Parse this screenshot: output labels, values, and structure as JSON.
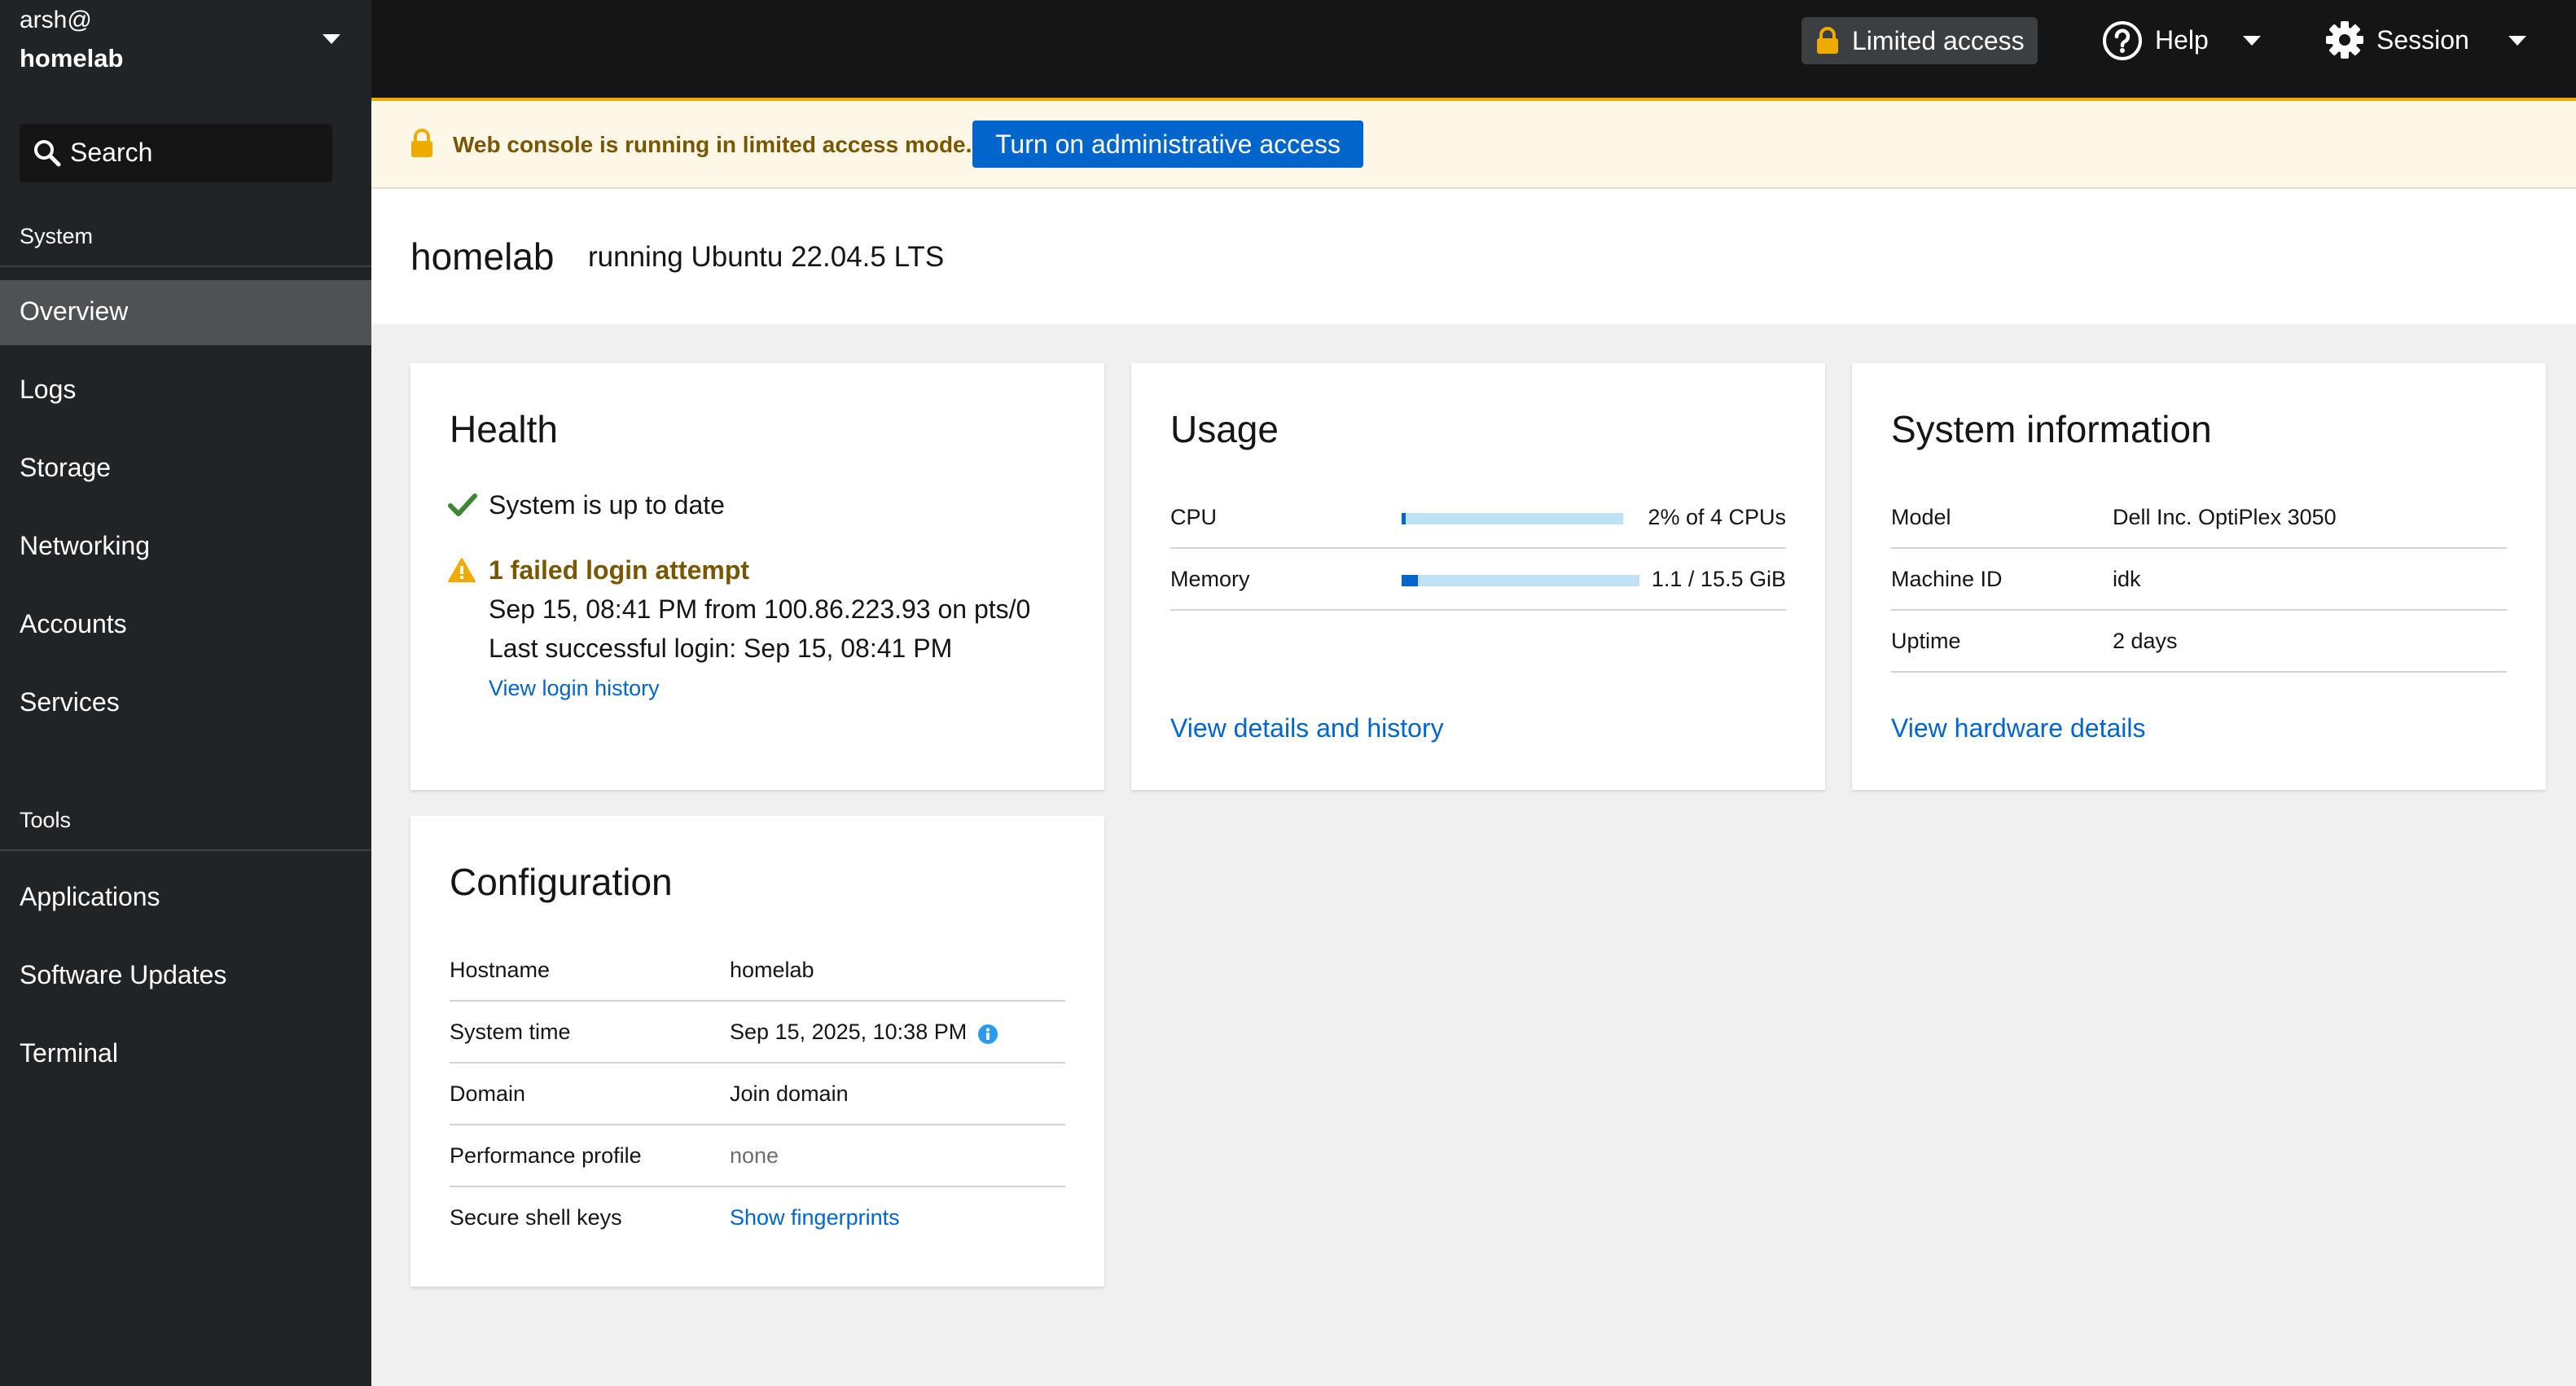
{
  "sidebar": {
    "user": "arsh@",
    "host": "homelab",
    "search_label": "Search",
    "section_system": "System",
    "system_items": [
      {
        "label": "Overview",
        "active": true
      },
      {
        "label": "Logs"
      },
      {
        "label": "Storage"
      },
      {
        "label": "Networking"
      },
      {
        "label": "Accounts"
      },
      {
        "label": "Services"
      }
    ],
    "section_tools": "Tools",
    "tools_items": [
      {
        "label": "Applications"
      },
      {
        "label": "Software Updates"
      },
      {
        "label": "Terminal"
      }
    ]
  },
  "topbar": {
    "limited_access": "Limited access",
    "help": "Help",
    "session": "Session"
  },
  "alert": {
    "text": "Web console is running in limited access mode.",
    "button": "Turn on administrative access"
  },
  "header": {
    "host": "homelab",
    "os": "running Ubuntu 22.04.5 LTS"
  },
  "health": {
    "title": "Health",
    "status_ok": "System is up to date",
    "warning_title": "1 failed login attempt",
    "warning_detail": "Sep 15, 08:41 PM from 100.86.223.93 on pts/0",
    "last_login": "Last successful login: Sep 15, 08:41 PM",
    "login_history_link": "View login history"
  },
  "usage": {
    "title": "Usage",
    "cpu_label": "CPU",
    "cpu_value": "2% of 4 CPUs",
    "cpu_fraction": 0.02,
    "memory_label": "Memory",
    "memory_value": "1.1 / 15.5 GiB",
    "memory_fraction": 0.07,
    "details_link": "View details and history"
  },
  "sysinfo": {
    "title": "System information",
    "rows": [
      {
        "label": "Model",
        "value": "Dell Inc. OptiPlex 3050"
      },
      {
        "label": "Machine ID",
        "value": "idk"
      },
      {
        "label": "Uptime",
        "value": "2 days"
      }
    ],
    "hardware_link": "View hardware details"
  },
  "config": {
    "title": "Configuration",
    "hostname_label": "Hostname",
    "hostname_value": "homelab",
    "time_label": "System time",
    "time_value": "Sep 15, 2025, 10:38 PM",
    "domain_label": "Domain",
    "domain_value": "Join domain",
    "profile_label": "Performance profile",
    "profile_value": "none",
    "ssh_label": "Secure shell keys",
    "ssh_value": "Show fingerprints"
  },
  "colors": {
    "sidebar": "#212427",
    "topbar": "#151515",
    "accent": "#0066cc",
    "warning": "#f0ab00",
    "success": "#3e8635"
  }
}
